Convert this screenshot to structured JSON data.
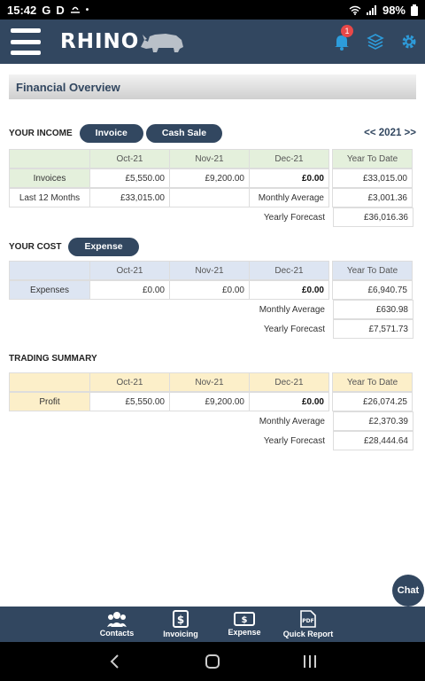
{
  "status_bar": {
    "time": "15:42",
    "left_icons": [
      "G",
      "D"
    ],
    "battery": "98%"
  },
  "header": {
    "logo_text": "RHINO",
    "notifications_count": "1"
  },
  "page": {
    "title": "Financial Overview"
  },
  "income": {
    "section_label": "YOUR INCOME",
    "buttons": [
      "Invoice",
      "Cash Sale"
    ],
    "year_nav": "<< 2021 >>",
    "months": [
      "Oct-21",
      "Nov-21",
      "Dec-21"
    ],
    "ytd_header": "Year To Date",
    "row_label": "Invoices",
    "values": [
      "£5,550.00",
      "£9,200.00",
      "£0.00"
    ],
    "ytd": "£33,015.00",
    "last12_label": "Last 12 Months",
    "last12_value": "£33,015.00",
    "monthly_avg_label": "Monthly Average",
    "monthly_avg": "£3,001.36",
    "yearly_forecast_label": "Yearly Forecast",
    "yearly_forecast": "£36,016.36"
  },
  "cost": {
    "section_label": "YOUR COST",
    "button": "Expense",
    "months": [
      "Oct-21",
      "Nov-21",
      "Dec-21"
    ],
    "ytd_header": "Year To Date",
    "row_label": "Expenses",
    "values": [
      "£0.00",
      "£0.00",
      "£0.00"
    ],
    "ytd": "£6,940.75",
    "monthly_avg_label": "Monthly Average",
    "monthly_avg": "£630.98",
    "yearly_forecast_label": "Yearly Forecast",
    "yearly_forecast": "£7,571.73"
  },
  "trading": {
    "section_label": "TRADING SUMMARY",
    "months": [
      "Oct-21",
      "Nov-21",
      "Dec-21"
    ],
    "ytd_header": "Year To Date",
    "row_label": "Profit",
    "values": [
      "£5,550.00",
      "£9,200.00",
      "£0.00"
    ],
    "ytd": "£26,074.25",
    "monthly_avg_label": "Monthly Average",
    "monthly_avg": "£2,370.39",
    "yearly_forecast_label": "Yearly Forecast",
    "yearly_forecast": "£28,444.64"
  },
  "chat": {
    "label": "Chat"
  },
  "bottom_nav": {
    "items": [
      "Contacts",
      "Invoicing",
      "Expense",
      "Quick Report"
    ]
  },
  "colors": {
    "primary": "#324760",
    "accent": "#2d9cdb",
    "income_highlight": "#e4f0dc",
    "cost_highlight": "#dde5f2",
    "trading_highlight": "#fcefc9",
    "badge": "#e84848"
  }
}
